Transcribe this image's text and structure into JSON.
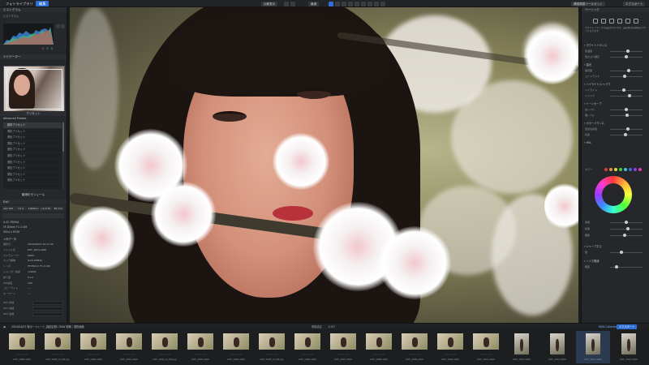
{
  "topbar": {
    "tab_library": "フォトライブラリ",
    "tab_edit": "編集",
    "compare_label": "比較表示",
    "fit_label": "最適",
    "right_label1": "構図調整ツールセット",
    "right_label2": "エクスポート"
  },
  "left": {
    "histogram_title": "ヒストグラム",
    "histogram_label": "ヒストグラム",
    "rgb_labels": [
      "R",
      "G",
      "B"
    ],
    "navigator_title": "ナビゲーター",
    "presets_title": "プリセット",
    "preset_group": "Advanced Presets",
    "presets": [
      "基本プリセット",
      "発色プリセット",
      "発色プリセット",
      "発色プリセット",
      "発色プリセット",
      "発色プリセット",
      "発色プリセット",
      "発色プリセット",
      "発色プリセット",
      "発色プリセット"
    ],
    "presets_footer": "最適化モジュール",
    "exif_title": "Exif",
    "exif_buttons": [
      "ISO 100",
      "f/1.2",
      "1/4000 s",
      "+0.0 EV",
      "85 mm"
    ],
    "camera": "ILCE-7RM4A",
    "lens": "FE 85mm F1.4 GM",
    "dimensions": "9504 x 6336",
    "metadata_title": "メタデータ",
    "meta_rows": [
      {
        "k": "撮影日",
        "v": "2024/04/07 10:17:34"
      },
      {
        "k": "ファイル名",
        "v": "DSF_3021.ARW"
      },
      {
        "k": "カメラメーカー",
        "v": "SONY"
      },
      {
        "k": "カメラ機種",
        "v": "ILCE-7RM4A"
      },
      {
        "k": "レンズ",
        "v": "FE 85mm F1.4 GM"
      },
      {
        "k": "シャッター速度",
        "v": "1/4000"
      },
      {
        "k": "絞り値",
        "v": "f/1.2"
      },
      {
        "k": "ISO感度",
        "v": "100"
      },
      {
        "k": "コピーライト",
        "v": "—"
      },
      {
        "k": "キーワード",
        "v": "—"
      }
    ],
    "iptc_rows": [
      "IPTC 情報",
      "IPTC 連絡",
      "IPTC 画像"
    ]
  },
  "right": {
    "panel_title": "ベーシック",
    "icons": [
      "crop-icon",
      "heal-icon",
      "brush-icon",
      "gradient-icon",
      "radial-icon",
      "eye-icon"
    ],
    "note": "ホワイトバランスの設定を行います。設定後は自動補正がオフになります。",
    "sections": [
      {
        "title": "ホワイトバランス",
        "rows": [
          {
            "label": "色温度",
            "pos": 0.55
          },
          {
            "label": "色かぶり補正",
            "pos": 0.5
          }
        ]
      },
      {
        "title": "露光",
        "rows": [
          {
            "label": "露光量",
            "pos": 0.58
          },
          {
            "label": "コントラスト",
            "pos": 0.45
          }
        ]
      },
      {
        "title": "ハイライト/シャドウ",
        "rows": [
          {
            "label": "ハイライト",
            "pos": 0.42
          },
          {
            "label": "シャドウ",
            "pos": 0.6
          }
        ]
      },
      {
        "title": "トーンカーブ",
        "rows": [
          {
            "label": "白レベル",
            "pos": 0.5
          },
          {
            "label": "黒レベル",
            "pos": 0.52
          }
        ]
      },
      {
        "title": "カラーバランス",
        "rows": [
          {
            "label": "自然な彩度",
            "pos": 0.55
          },
          {
            "label": "彩度",
            "pos": 0.48
          }
        ]
      },
      {
        "title": "HSL",
        "rows": []
      }
    ],
    "hsl_label": "カラー",
    "wheel_sliders": [
      {
        "label": "色相",
        "pos": 0.5
      },
      {
        "label": "彩度",
        "pos": 0.55
      },
      {
        "label": "輝度",
        "pos": 0.46
      }
    ],
    "bottom_sections": [
      {
        "title": "シャープネス",
        "rows": [
          {
            "label": "量",
            "pos": 0.35
          }
        ]
      },
      {
        "title": "ノイズ軽減",
        "rows": [
          {
            "label": "輝度",
            "pos": 0.2
          }
        ]
      }
    ],
    "colors": [
      "#e03b3b",
      "#e6903b",
      "#e6d63b",
      "#3bd04b",
      "#3bc6d6",
      "#3b6fe0",
      "#9a3be0",
      "#e03bb8"
    ]
  },
  "strip": {
    "path": "2024/04/07 桜ポートレート_撮影記録 / RAW 現像 / 選択画像",
    "count": "1/197",
    "center_label": "現像設定",
    "collection_label": "RAW Collection",
    "export_label": "エクスポート"
  },
  "thumbnails": [
    {
      "name": "DSF_2988.ARW",
      "portrait": false,
      "selected": false
    },
    {
      "name": "DSF_2989_AI_DN.jpg",
      "portrait": false,
      "selected": false
    },
    {
      "name": "DSF_2990.ARW",
      "portrait": false,
      "selected": false
    },
    {
      "name": "DSF_2991.ARW",
      "portrait": false,
      "selected": false
    },
    {
      "name": "DSF_2992_AI_DN.jpg",
      "portrait": false,
      "selected": false
    },
    {
      "name": "DSF_2993.ARW",
      "portrait": false,
      "selected": false
    },
    {
      "name": "DSF_2994.ARW",
      "portrait": false,
      "selected": false
    },
    {
      "name": "DSF_2995_AI_DN.jpg",
      "portrait": false,
      "selected": false
    },
    {
      "name": "DSF_2996.ARW",
      "portrait": false,
      "selected": false
    },
    {
      "name": "DSF_2997.ARW",
      "portrait": false,
      "selected": false
    },
    {
      "name": "DSF_2998.ARW",
      "portrait": false,
      "selected": false
    },
    {
      "name": "DSF_2999.ARW",
      "portrait": false,
      "selected": false
    },
    {
      "name": "DSF_3000.ARW",
      "portrait": false,
      "selected": false
    },
    {
      "name": "DSF_3001.ARW",
      "portrait": false,
      "selected": false
    },
    {
      "name": "DSF_3010.ARW",
      "portrait": true,
      "selected": false
    },
    {
      "name": "DSF_3015.ARW",
      "portrait": true,
      "selected": false
    },
    {
      "name": "DSF_3021.ARW",
      "portrait": true,
      "selected": true
    },
    {
      "name": "DSF_3022.ARW",
      "portrait": true,
      "selected": false
    }
  ]
}
